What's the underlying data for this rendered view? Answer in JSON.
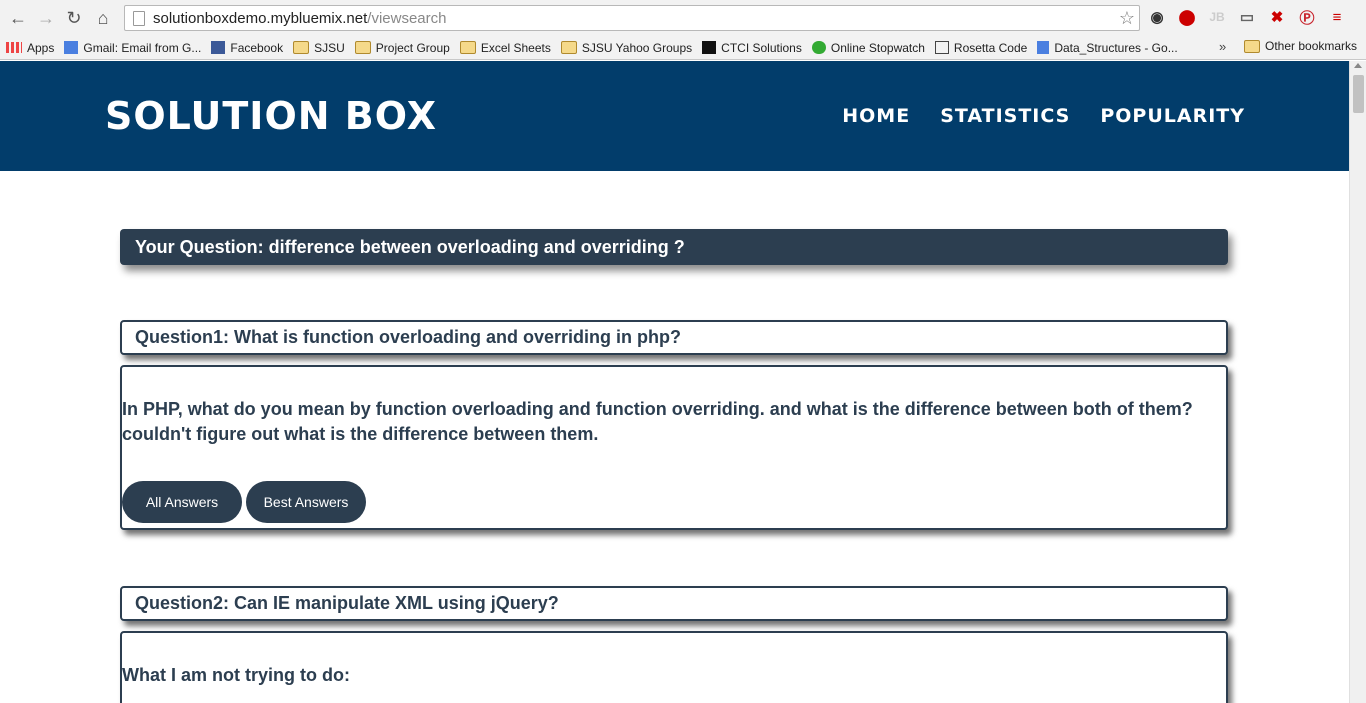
{
  "browser": {
    "url_host": "solutionboxdemo.mybluemix.net",
    "url_path": "/viewsearch",
    "bookmarks": [
      {
        "label": "Apps",
        "icon": "apps-grid-icon"
      },
      {
        "label": "Gmail: Email from G...",
        "icon": "google-icon"
      },
      {
        "label": "Facebook",
        "icon": "facebook-icon"
      },
      {
        "label": "SJSU",
        "icon": "folder-icon"
      },
      {
        "label": "Project Group",
        "icon": "folder-icon"
      },
      {
        "label": "Excel Sheets",
        "icon": "folder-icon"
      },
      {
        "label": "SJSU Yahoo Groups",
        "icon": "folder-icon"
      },
      {
        "label": "CTCI Solutions",
        "icon": "ctci-icon"
      },
      {
        "label": "Online Stopwatch",
        "icon": "stopwatch-icon"
      },
      {
        "label": "Rosetta Code",
        "icon": "rosetta-icon"
      },
      {
        "label": "Data_Structures - Go...",
        "icon": "docs-icon"
      }
    ],
    "more_label": "»",
    "other_bookmarks": "Other bookmarks"
  },
  "site": {
    "logo": "SOLUTION BOX",
    "nav": [
      "HOME",
      "STATISTICS",
      "POPULARITY"
    ]
  },
  "search": {
    "your_question": "Your Question: difference between overloading and overriding ?"
  },
  "questions": [
    {
      "title": "Question1: What is function overloading and overriding in php?",
      "body": "In PHP, what do you mean by function overloading and function overriding. and what is the difference between both of them? couldn't figure out what is the difference between them.",
      "all_answers": "All Answers",
      "best_answers": "Best Answers"
    },
    {
      "title": "Question2: Can IE manipulate XML using jQuery?",
      "body": "What I am not trying to do:"
    }
  ],
  "colors": {
    "header_bg": "#023d6b",
    "accent_dark": "#2c3e50"
  }
}
